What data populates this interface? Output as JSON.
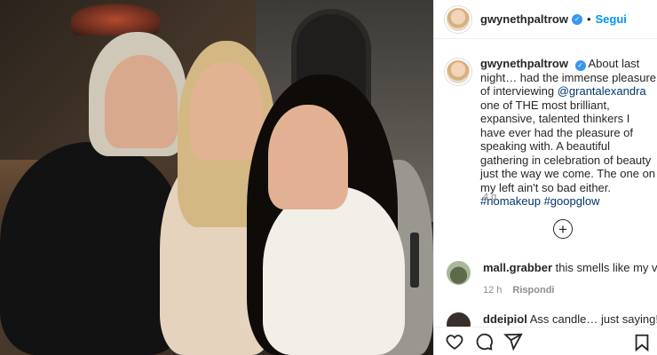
{
  "post": {
    "username": "gwynethpaltrow",
    "follow_separator": "•",
    "follow_label": "Segui",
    "caption": {
      "username": "gwynethpaltrow",
      "part1": "About last night… had the immense pleasure of interviewing ",
      "mention": "@grantalexandra",
      "part2": " one of THE most brilliant, expansive, talented thinkers I have ever had the pleasure of speaking with. A beautiful gathering in celebration of beauty just the way we come. The one on my left ain't so bad either. ",
      "hashtag1": "#nomakeup",
      "hashtag2": "#goopglow"
    },
    "time_ago": "4 g",
    "load_more_icon": "plus-circle-icon"
  },
  "comments": [
    {
      "username": "mall.grabber",
      "text": "this smells like my vagi",
      "time": "12 h",
      "reply_label": "Rispondi"
    },
    {
      "username": "ddeipiol",
      "text": "Ass candle… just saying!"
    }
  ],
  "colors": {
    "link": "#00376b",
    "follow": "#0095f6",
    "verified": "#3897f0",
    "meta": "#8e8e8e"
  },
  "actions": [
    "heart-icon",
    "comment-icon",
    "share-icon",
    "bookmark-icon"
  ]
}
